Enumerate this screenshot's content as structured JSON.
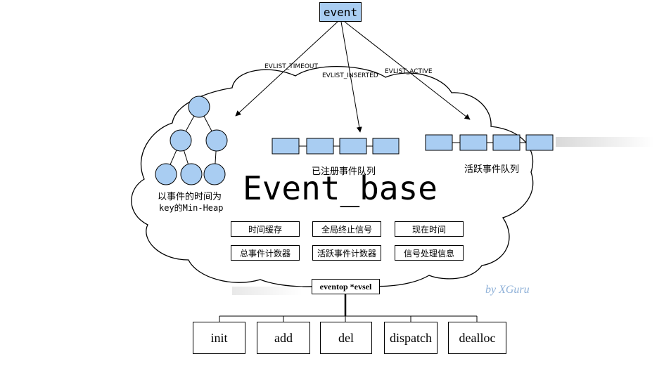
{
  "root": {
    "label": "event"
  },
  "edges": {
    "timeout": "EVLIST_TIMEOUT",
    "inserted": "EVLIST_INSERTED",
    "active": "EVLIST_ACTIVE"
  },
  "heap": {
    "caption_line1": "以事件的时间为",
    "caption_line2": "key的Min-Heap"
  },
  "queues": {
    "registered": "已注册事件队列",
    "active": "活跃事件队列"
  },
  "base": {
    "title": "Event_base"
  },
  "fields": [
    "时间缓存",
    "全局终止信号",
    "现在时间",
    "总事件计数器",
    "活跃事件计数器",
    "信号处理信息"
  ],
  "evsel": "eventop *evsel",
  "ops": [
    "init",
    "add",
    "del",
    "dispatch",
    "dealloc"
  ],
  "signature": "by XGuru",
  "colors": {
    "node_fill": "#a9cdf2",
    "line": "#000000"
  }
}
